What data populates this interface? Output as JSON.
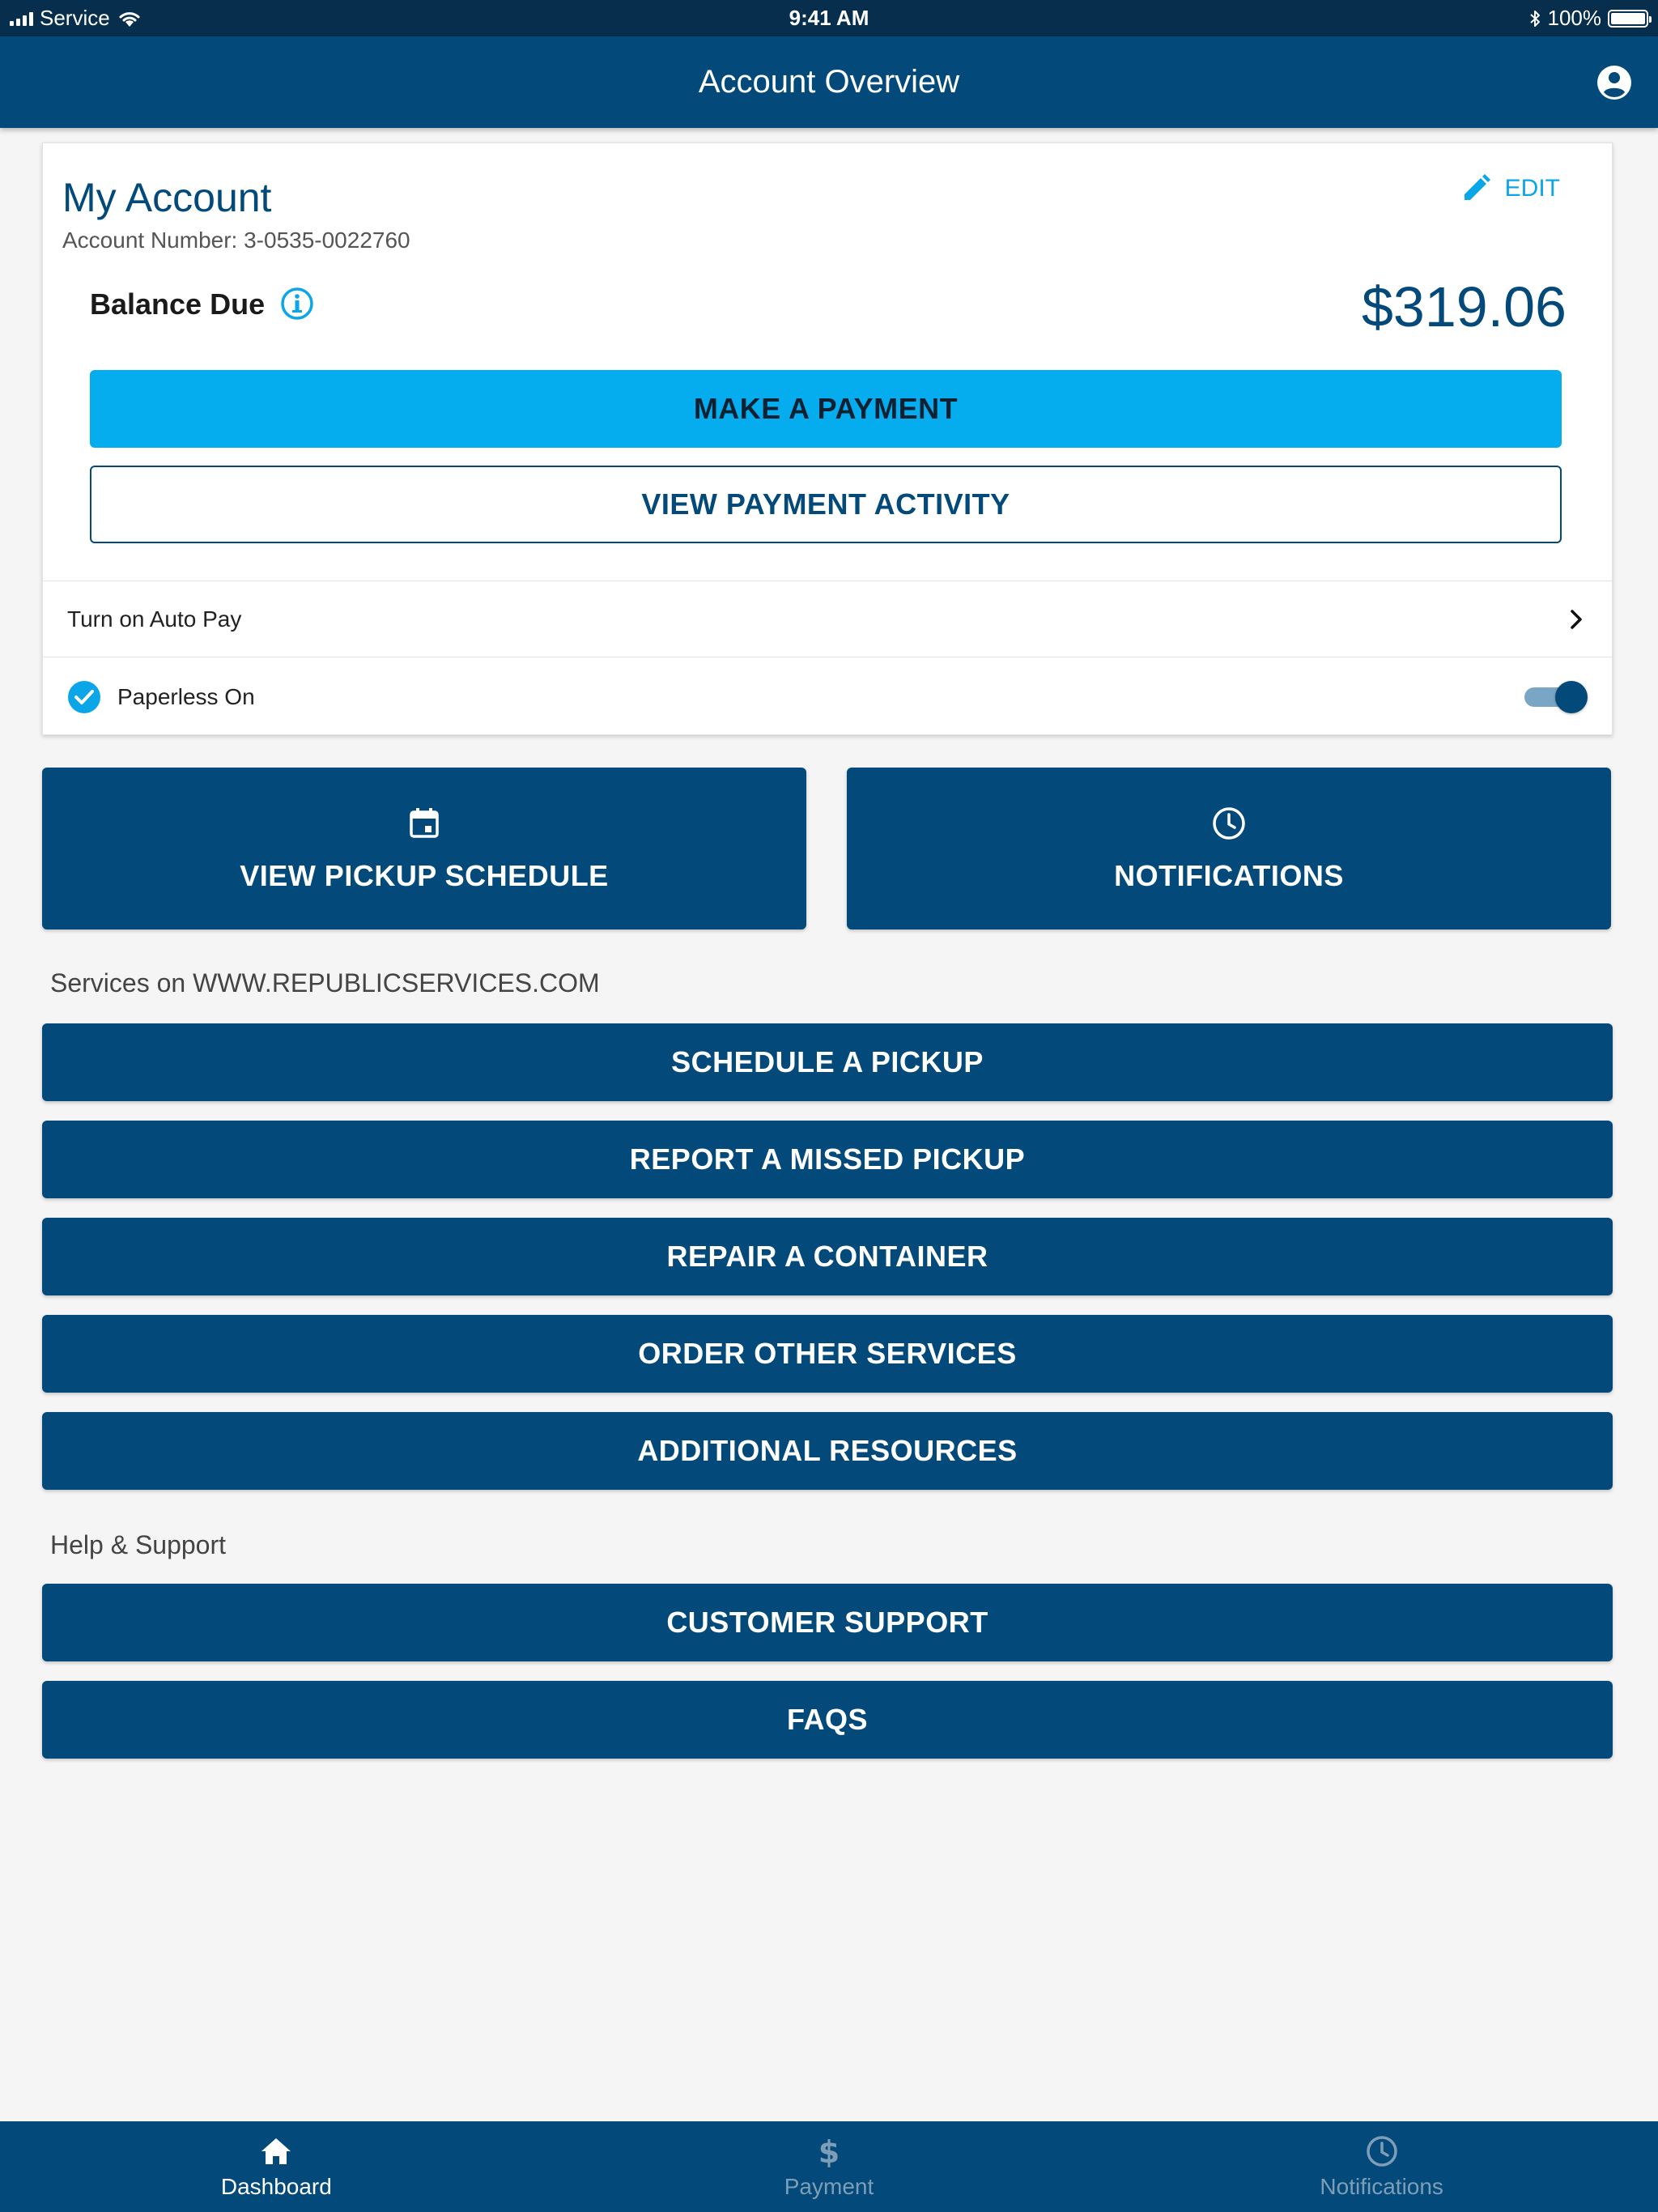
{
  "status_bar": {
    "carrier": "Service",
    "time": "9:41 AM",
    "battery": "100%"
  },
  "nav": {
    "title": "Account Overview",
    "profile_icon": "account-circle-icon"
  },
  "account": {
    "title": "My Account",
    "account_number": "Account Number: 3-0535-0022760",
    "edit_label": "EDIT",
    "balance_label": "Balance Due",
    "balance_amount": "$319.06",
    "make_payment_label": "MAKE A PAYMENT",
    "view_activity_label": "VIEW PAYMENT ACTIVITY",
    "autopay_label": "Turn on Auto Pay",
    "paperless_label": "Paperless On",
    "paperless_on": true
  },
  "tiles": {
    "pickup_schedule": "VIEW PICKUP SCHEDULE",
    "notifications": "NOTIFICATIONS"
  },
  "services": {
    "heading": "Services on WWW.REPUBLICSERVICES.COM",
    "buttons": [
      "SCHEDULE A PICKUP",
      "REPORT A MISSED PICKUP",
      "REPAIR A CONTAINER",
      "ORDER OTHER SERVICES",
      "ADDITIONAL RESOURCES"
    ]
  },
  "help": {
    "heading": "Help & Support",
    "buttons": [
      "CUSTOMER SUPPORT",
      "FAQS"
    ]
  },
  "tabbar": {
    "tabs": [
      {
        "label": "Dashboard",
        "icon": "home-icon",
        "active": true
      },
      {
        "label": "Payment",
        "icon": "dollar-icon",
        "active": false
      },
      {
        "label": "Notifications",
        "icon": "clock-icon",
        "active": false
      }
    ]
  },
  "colors": {
    "navy": "#034a7a",
    "accent": "#05adef",
    "status_bar": "#072f4d"
  }
}
